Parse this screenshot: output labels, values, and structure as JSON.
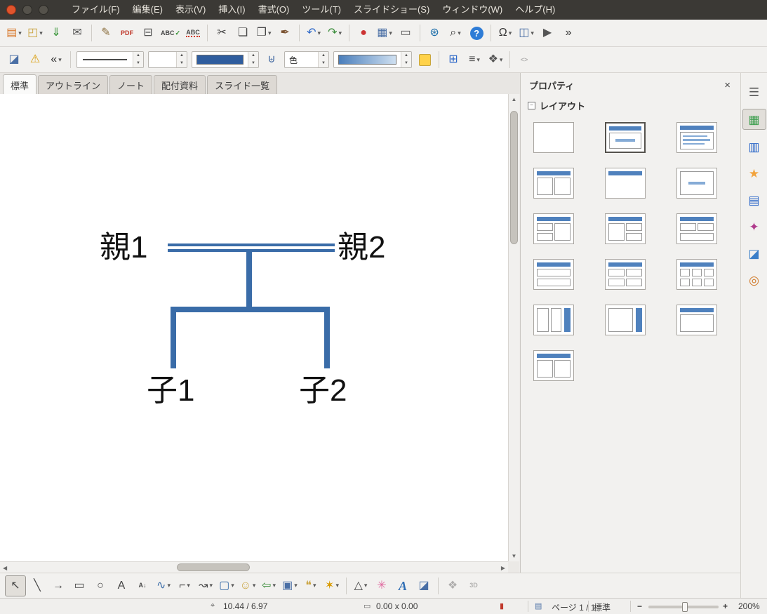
{
  "menubar": {
    "items": [
      {
        "name": "file",
        "label": "ファイル(F)"
      },
      {
        "name": "edit",
        "label": "編集(E)"
      },
      {
        "name": "view",
        "label": "表示(V)"
      },
      {
        "name": "insert",
        "label": "挿入(I)"
      },
      {
        "name": "format",
        "label": "書式(O)"
      },
      {
        "name": "tools",
        "label": "ツール(T)"
      },
      {
        "name": "slideshow",
        "label": "スライドショー(S)"
      },
      {
        "name": "window",
        "label": "ウィンドウ(W)"
      },
      {
        "name": "help",
        "label": "ヘルプ(H)"
      }
    ]
  },
  "toolbar_main": {
    "items": [
      {
        "name": "new-presentation",
        "glyph": "▤",
        "color": "#D97B2F",
        "dropdown": true
      },
      {
        "name": "open",
        "glyph": "◰",
        "color": "#C9A23C",
        "dropdown": true
      },
      {
        "name": "save",
        "glyph": "⇓",
        "color": "#2D8F2D"
      },
      {
        "name": "send-email",
        "glyph": "✉",
        "color": "#555555"
      },
      {
        "sep": true
      },
      {
        "name": "edit-file",
        "glyph": "✎",
        "color": "#8A6D3B"
      },
      {
        "name": "export-pdf",
        "glyph": "PDF",
        "small": true,
        "color": "#C0392B"
      },
      {
        "name": "print",
        "glyph": "⊟",
        "color": "#555555"
      },
      {
        "name": "spelling",
        "glyph": "ABC",
        "small": true,
        "check": true
      },
      {
        "name": "auto-spellcheck",
        "glyph": "ABC",
        "small": true,
        "underline": true
      },
      {
        "sep": true
      },
      {
        "name": "cut",
        "glyph": "✂"
      },
      {
        "name": "copy",
        "glyph": "❏"
      },
      {
        "name": "paste",
        "glyph": "❐",
        "dropdown": true
      },
      {
        "name": "clone-formatting",
        "glyph": "✒",
        "color": "#7A5230"
      },
      {
        "sep": true
      },
      {
        "name": "undo",
        "glyph": "↶",
        "color": "#2A66C8",
        "dropdown": true
      },
      {
        "name": "redo",
        "glyph": "↷",
        "color": "#3A8D3A",
        "dropdown": true
      },
      {
        "sep": true
      },
      {
        "name": "insert-chart",
        "glyph": "●",
        "color": "#CC3333"
      },
      {
        "name": "insert-table",
        "glyph": "▦",
        "color": "#4A6FA5",
        "dropdown": true
      },
      {
        "name": "insert-frame",
        "glyph": "▭",
        "color": "#555555"
      },
      {
        "sep": true
      },
      {
        "name": "hyperlink",
        "glyph": "⊛",
        "color": "#1C6EAA"
      },
      {
        "name": "zoom",
        "glyph": "⌕",
        "color": "#333333",
        "dropdown": true
      },
      {
        "name": "help",
        "glyph": "?",
        "badge": "circle"
      },
      {
        "sep": true
      },
      {
        "name": "special-character",
        "glyph": "Ω",
        "color": "#333333",
        "dropdown": true
      },
      {
        "name": "display-views",
        "glyph": "◫",
        "color": "#4A6FA5",
        "dropdown": true
      },
      {
        "name": "start-slideshow",
        "glyph": "▶",
        "color": "#555555"
      },
      {
        "name": "toolbar-overflow",
        "glyph": "»",
        "color": "#333333"
      }
    ]
  },
  "toolbar_line": {
    "items_left": [
      {
        "name": "insert-image",
        "glyph": "◪",
        "color": "#4A6FA5"
      },
      {
        "name": "helplines-while-moving",
        "glyph": "⚠",
        "color": "#D89A00"
      },
      {
        "name": "arrow-style",
        "glyph": "«",
        "color": "#333333",
        "dropdown": true
      },
      {
        "sep": true
      }
    ],
    "line_width_value": "",
    "line_color": "#2F5D9E",
    "fill_type_value": "色",
    "fill_gradient_start": "#4A7EBB",
    "fill_gradient_end": "#CFE0F1",
    "items_right": [
      {
        "sep": true
      },
      {
        "name": "display-grid",
        "glyph": "⊞",
        "color": "#2A66C8"
      },
      {
        "name": "align-objects",
        "glyph": "≡",
        "color": "#555555",
        "dropdown": true
      },
      {
        "name": "arrange-objects",
        "glyph": "❖",
        "color": "#555555",
        "dropdown": true
      },
      {
        "sep": true
      },
      {
        "name": "show-draw-functions",
        "glyph": "<>",
        "small": true,
        "disabled": true
      }
    ]
  },
  "view_tabs": {
    "items": [
      {
        "name": "normal",
        "label": "標準",
        "active": true
      },
      {
        "name": "outline",
        "label": "アウトライン",
        "active": false
      },
      {
        "name": "notes",
        "label": "ノート",
        "active": false
      },
      {
        "name": "handout",
        "label": "配付資料",
        "active": false
      },
      {
        "name": "slide-sorter",
        "label": "スライド一覧",
        "active": false
      }
    ]
  },
  "slide": {
    "labels": {
      "parent1": "親1",
      "parent2": "親2",
      "child1": "子1",
      "child2": "子2"
    },
    "line_color": "#3A6CA8"
  },
  "sidebar": {
    "title": "プロパティ",
    "close_glyph": "×",
    "sections": [
      {
        "title": "レイアウト",
        "collapse_glyph": "−"
      }
    ],
    "layouts": [
      {
        "name": "blank",
        "selected": false
      },
      {
        "name": "title-slide",
        "selected": true
      },
      {
        "name": "title-content",
        "selected": false
      },
      {
        "name": "title-two-content",
        "selected": false
      },
      {
        "name": "title-only",
        "selected": false
      },
      {
        "name": "centered-text",
        "selected": false
      },
      {
        "name": "title-two-content-and-content",
        "selected": false
      },
      {
        "name": "title-content-and-two-content",
        "selected": false
      },
      {
        "name": "title-two-content-over-content",
        "selected": false
      },
      {
        "name": "title-content-over-content",
        "selected": false
      },
      {
        "name": "title-four-content",
        "selected": false
      },
      {
        "name": "title-six-content",
        "selected": false
      },
      {
        "name": "vertical-title-vertical-text",
        "selected": false
      },
      {
        "name": "vertical-title-text-chart",
        "selected": false
      },
      {
        "name": "title-vertical-text",
        "selected": false
      },
      {
        "name": "title-two-vertical-text-clipart",
        "selected": false
      }
    ]
  },
  "sidebar_tabs": {
    "items": [
      {
        "name": "sidebar-settings",
        "glyph": "☰",
        "color": "#555555"
      },
      {
        "name": "properties-deck",
        "glyph": "▦",
        "color": "#3D9E4E",
        "active": true
      },
      {
        "name": "styles-deck",
        "glyph": "▥",
        "color": "#2A66C8"
      },
      {
        "name": "gallery-deck",
        "glyph": "★",
        "color": "#F2A33C"
      },
      {
        "name": "slide-transition-deck",
        "glyph": "▤",
        "color": "#2A66C8"
      },
      {
        "name": "animation-deck",
        "glyph": "✦",
        "color": "#B03A8C"
      },
      {
        "name": "master-slides-deck",
        "glyph": "◪",
        "color": "#3A7EC8"
      },
      {
        "name": "navigator-deck",
        "glyph": "◎",
        "color": "#D07A2A"
      }
    ]
  },
  "draw_toolbar": {
    "items": [
      {
        "name": "select",
        "glyph": "↖",
        "active": true
      },
      {
        "name": "insert-line",
        "glyph": "╲"
      },
      {
        "name": "line-ends-with-arrow",
        "glyph": "→"
      },
      {
        "name": "rectangle",
        "glyph": "▭"
      },
      {
        "name": "ellipse",
        "glyph": "○"
      },
      {
        "name": "insert-textbox",
        "glyph": "A"
      },
      {
        "name": "vertical-textbox",
        "glyph": "A↓",
        "small": true
      },
      {
        "name": "curves-and-polygons",
        "glyph": "∿",
        "color": "#3A6CA8",
        "dropdown": true
      },
      {
        "name": "connectors",
        "glyph": "⌐",
        "dropdown": true
      },
      {
        "name": "lines-and-arrows",
        "glyph": "↝",
        "dropdown": true
      },
      {
        "name": "basic-shapes",
        "glyph": "▢",
        "color": "#3A6CA8",
        "dropdown": true
      },
      {
        "name": "symbol-shapes",
        "glyph": "☺",
        "color": "#C9A23C",
        "dropdown": true
      },
      {
        "name": "block-arrows",
        "glyph": "⇦",
        "color": "#3A8D3A",
        "dropdown": true
      },
      {
        "name": "flowchart",
        "glyph": "▣",
        "color": "#4A6FA5",
        "dropdown": true
      },
      {
        "name": "callouts",
        "glyph": "❝",
        "color": "#C9A23C",
        "dropdown": true
      },
      {
        "name": "stars-and-banners",
        "glyph": "✶",
        "color": "#D89A00",
        "dropdown": true
      },
      {
        "sep": true
      },
      {
        "name": "edit-points",
        "glyph": "△",
        "dropdown": true
      },
      {
        "name": "glue-points",
        "glyph": "✳",
        "color": "#E06AA0"
      },
      {
        "name": "fontwork",
        "glyph": "A",
        "fontwork": true
      },
      {
        "name": "insert-picture",
        "glyph": "◪",
        "color": "#4A6FA5"
      },
      {
        "sep": true
      },
      {
        "name": "arrange",
        "glyph": "❖",
        "disabled": true
      },
      {
        "name": "toggle-extrusion",
        "glyph": "3D",
        "small": true,
        "disabled": true
      }
    ]
  },
  "statusbar": {
    "position": "10.44 / 6.97",
    "size": "0.00 x 0.00",
    "page": "ページ 1 / 1",
    "style_name": "標準",
    "zoom_out": "−",
    "zoom_in": "+",
    "zoom_level": "200%"
  }
}
